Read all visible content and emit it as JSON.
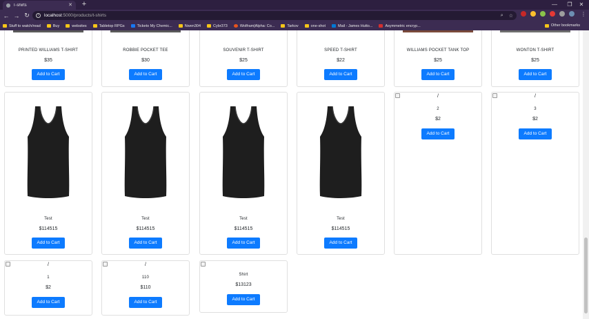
{
  "browser": {
    "tab_title": "T-shirts",
    "url_host": "localhost",
    "url_path": ":5000/products/t-shirts",
    "bookmarks": [
      "Stuff to watch/read",
      "Buy",
      "websites",
      "Tabletop RPGs",
      "Ticketo My Chemic...",
      "Nwen304",
      "Cybr373",
      "Wolfram|Alpha: Co...",
      "Tarkov",
      "one-shot",
      "Mail - James Hutto...",
      "Asymmetric encryp..."
    ],
    "other_bookmarks": "Other bookmarks"
  },
  "products_top": [
    {
      "name": "PRINTED WILLIAMS T-SHIRT",
      "price": "$35",
      "button": "Add to Cart"
    },
    {
      "name": "ROBBIE POCKET TEE",
      "price": "$30",
      "button": "Add to Cart"
    },
    {
      "name": "SOUVENIR T-SHIRT",
      "price": "$25",
      "button": "Add to Cart"
    },
    {
      "name": "SPEED T-SHIRT",
      "price": "$22",
      "button": "Add to Cart"
    },
    {
      "name": "WILLIAMS POCKET TANK TOP",
      "price": "$25",
      "button": "Add to Cart"
    },
    {
      "name": "WONTON T-SHIRT",
      "price": "$25",
      "button": "Add to Cart"
    }
  ],
  "products_mid": [
    {
      "name": "Test",
      "price": "$114515",
      "button": "Add to Cart"
    },
    {
      "name": "Test",
      "price": "$114515",
      "button": "Add to Cart"
    },
    {
      "name": "Test",
      "price": "$114515",
      "button": "Add to Cart"
    },
    {
      "name": "Test",
      "price": "$114515",
      "button": "Add to Cart"
    },
    {
      "alt": "/",
      "name": "2",
      "price": "$2",
      "button": "Add to Cart"
    },
    {
      "alt": "/",
      "name": "3",
      "price": "$2",
      "button": "Add to Cart"
    }
  ],
  "products_bottom": [
    {
      "alt": "/",
      "name": "1",
      "price": "$2",
      "button": "Add to Cart"
    },
    {
      "alt": "/",
      "name": "110",
      "price": "$110",
      "button": "Add to Cart"
    },
    {
      "name": "Shirt",
      "price": "$13123",
      "button": "Add to Cart"
    }
  ]
}
